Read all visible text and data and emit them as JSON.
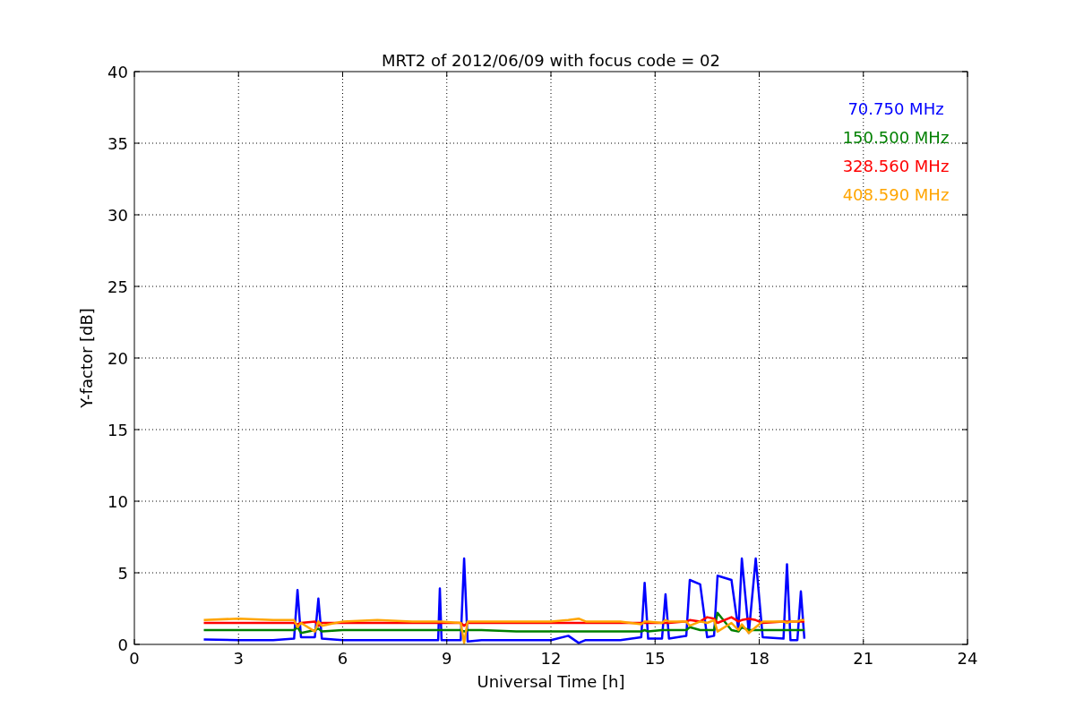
{
  "figure": {
    "chart_data": {
      "type": "line",
      "title": "MRT2 of 2012/06/09 with focus code = 02",
      "xlabel": "Universal Time [h]",
      "ylabel": "Y-factor [dB]",
      "x": [
        2,
        3,
        4,
        4.6,
        4.7,
        4.8,
        5.2,
        5.3,
        5.4,
        6,
        7,
        8,
        8.75,
        8.8,
        8.85,
        9.4,
        9.5,
        9.6,
        10,
        11,
        12,
        12.5,
        12.8,
        13,
        14,
        14.6,
        14.7,
        14.8,
        15.2,
        15.3,
        15.4,
        15.9,
        16,
        16.3,
        16.5,
        16.7,
        16.8,
        17.2,
        17.4,
        17.5,
        17.7,
        17.9,
        18.1,
        18.7,
        18.8,
        18.9,
        19.1,
        19.2,
        19.3
      ],
      "series": [
        {
          "name": "70.750 MHz",
          "color": "#0000ff",
          "values": [
            0.35,
            0.3,
            0.3,
            0.4,
            3.8,
            0.5,
            0.5,
            3.2,
            0.4,
            0.3,
            0.3,
            0.3,
            0.3,
            3.9,
            0.3,
            0.3,
            6,
            0.2,
            0.3,
            0.3,
            0.3,
            0.6,
            0.1,
            0.3,
            0.3,
            0.5,
            4.3,
            0.4,
            0.4,
            3.5,
            0.4,
            0.6,
            4.5,
            4.2,
            0.5,
            0.6,
            4.8,
            4.5,
            1,
            6,
            0.8,
            6,
            0.5,
            0.4,
            5.6,
            0.3,
            0.3,
            3.7,
            0.4
          ]
        },
        {
          "name": "150.500 MHz",
          "color": "#008000",
          "values": [
            1.0,
            1.0,
            1.0,
            1.0,
            1.2,
            0.8,
            1.0,
            1.1,
            0.9,
            1.0,
            1.0,
            1.0,
            1.0,
            1.0,
            1.0,
            1.0,
            0.9,
            1.0,
            1.0,
            0.9,
            0.9,
            0.9,
            0.9,
            0.9,
            0.9,
            0.9,
            1.0,
            0.9,
            1.0,
            1.0,
            1.0,
            1.0,
            1.2,
            1.0,
            1.0,
            1.0,
            2.2,
            1.0,
            0.9,
            1.2,
            1.0,
            1.0,
            1.0,
            1.0,
            1.0,
            1.0,
            1.0,
            1.0,
            1.0
          ]
        },
        {
          "name": "328.560 MHz",
          "color": "#ff0000",
          "values": [
            1.5,
            1.5,
            1.5,
            1.5,
            1.4,
            1.5,
            1.6,
            1.3,
            1.5,
            1.5,
            1.5,
            1.5,
            1.5,
            1.5,
            1.5,
            1.5,
            1.3,
            1.5,
            1.5,
            1.5,
            1.5,
            1.5,
            1.5,
            1.5,
            1.5,
            1.5,
            1.5,
            1.5,
            1.5,
            1.5,
            1.5,
            1.6,
            1.7,
            1.6,
            1.9,
            1.8,
            1.5,
            1.9,
            1.6,
            1.7,
            1.8,
            1.7,
            1.5,
            1.6,
            1.6,
            1.6,
            1.6,
            1.6,
            1.6
          ]
        },
        {
          "name": "408.590 MHz",
          "color": "#ffa500",
          "values": [
            1.7,
            1.8,
            1.7,
            1.7,
            1.2,
            1.5,
            0.9,
            1.6,
            1.3,
            1.6,
            1.7,
            1.6,
            1.6,
            1.6,
            1.6,
            1.5,
            0.1,
            1.6,
            1.6,
            1.6,
            1.6,
            1.7,
            1.8,
            1.6,
            1.6,
            1.4,
            1.6,
            1.6,
            1.5,
            1.7,
            1.6,
            1.6,
            1.3,
            1.6,
            1.5,
            1.7,
            0.9,
            1.5,
            1.0,
            1.4,
            0.8,
            1.2,
            1.6,
            1.6,
            1.5,
            1.6,
            1.6,
            1.7,
            1.7
          ]
        }
      ],
      "grid": true,
      "xlim": [
        0,
        24
      ],
      "ylim": [
        0,
        40
      ],
      "xticks": [
        0,
        3,
        6,
        9,
        12,
        15,
        18,
        21,
        24
      ],
      "yticks": [
        0,
        5,
        10,
        15,
        20,
        25,
        30,
        35,
        40
      ]
    }
  }
}
